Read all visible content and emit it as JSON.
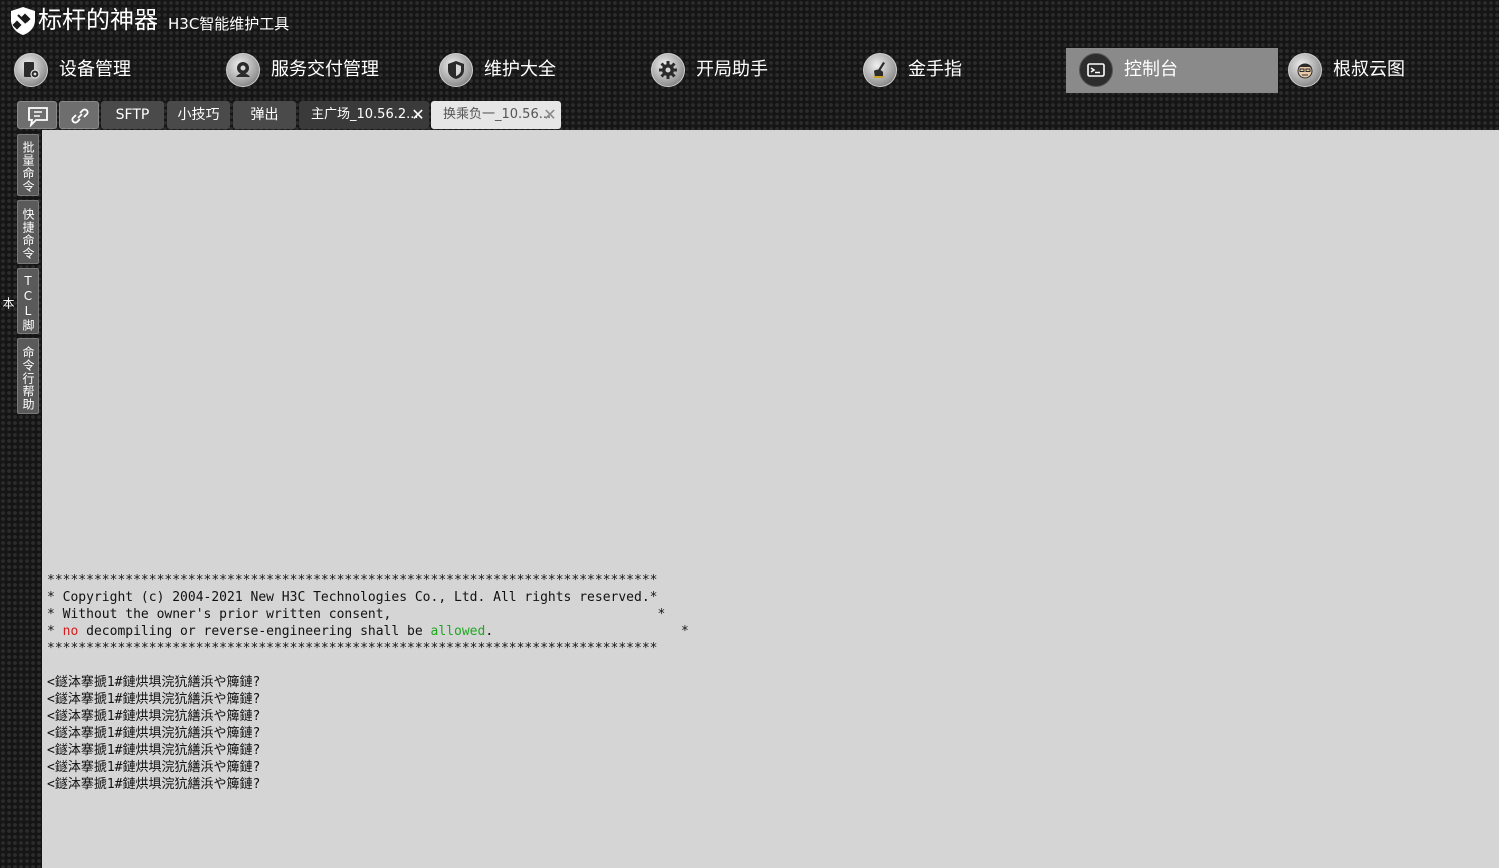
{
  "header": {
    "title": "标杆的神器",
    "subtitle": "H3C智能维护工具",
    "logo_icon": "shield-wrench-icon"
  },
  "nav": {
    "items": [
      {
        "label": "设备管理",
        "icon": "device-gear-icon",
        "active": false
      },
      {
        "label": "服务交付管理",
        "icon": "service-delivery-icon",
        "active": false
      },
      {
        "label": "维护大全",
        "icon": "shield-icon",
        "active": false
      },
      {
        "label": "开局助手",
        "icon": "gear-icon",
        "active": false
      },
      {
        "label": "金手指",
        "icon": "pointing-hand-icon",
        "active": false
      },
      {
        "label": "控制台",
        "icon": "terminal-icon",
        "active": true
      },
      {
        "label": "根叔云图",
        "icon": "avatar-face-icon",
        "active": false
      }
    ]
  },
  "tabbar": {
    "tools": [
      {
        "icon": "chat-bubble-icon"
      },
      {
        "icon": "link-icon"
      }
    ],
    "tabs": [
      {
        "label": "SFTP"
      },
      {
        "label": "小技巧"
      },
      {
        "label": "弹出"
      }
    ],
    "sessions": [
      {
        "label": "主广场_10.56.2...",
        "active": false
      },
      {
        "label": "换乘负一_10.56...",
        "active": true
      }
    ]
  },
  "side_rail": {
    "items": [
      "批量命令",
      "快捷命令",
      "TCL脚本",
      "命令行帮助"
    ]
  },
  "console": {
    "banner": {
      "stars_line": "******************************************************************************",
      "copyright_line": "* Copyright (c) 2004-2021 New H3C Technologies Co., Ltd. All rights reserved.*",
      "consent_line": "* Without the owner's prior written consent,                                  *",
      "prefix": "* ",
      "word_no": "no",
      "middle": " decompiling or reverse-engineering shall be ",
      "word_allowed": "allowed",
      "suffix": ".                        *"
    },
    "prompt_lines": [
      "<鐩泍搴搋1#鏈烘埧浣犺繕浜や簰鏈?",
      "<鐩泍搴搋1#鏈烘埧浣犺繕浜や簰鏈?",
      "<鐩泍搴搋1#鏈烘埧浣犺繕浜や簰鏈?",
      "<鐩泍搴搋1#鏈烘埧浣犺繕浜や簰鏈?",
      "<鐩泍搴搋1#鏈烘埧浣犺繕浜や簰鏈?",
      "<鐩泍搴搋1#鏈烘埧浣犺繕浜や簰鏈?",
      "<鐩泍搴搋1#鏈烘埧浣犺繕浜や簰鏈?"
    ],
    "colors": {
      "background": "#d6d5d6",
      "highlight_red": "#d21c1c",
      "highlight_green": "#1fa81f"
    }
  }
}
